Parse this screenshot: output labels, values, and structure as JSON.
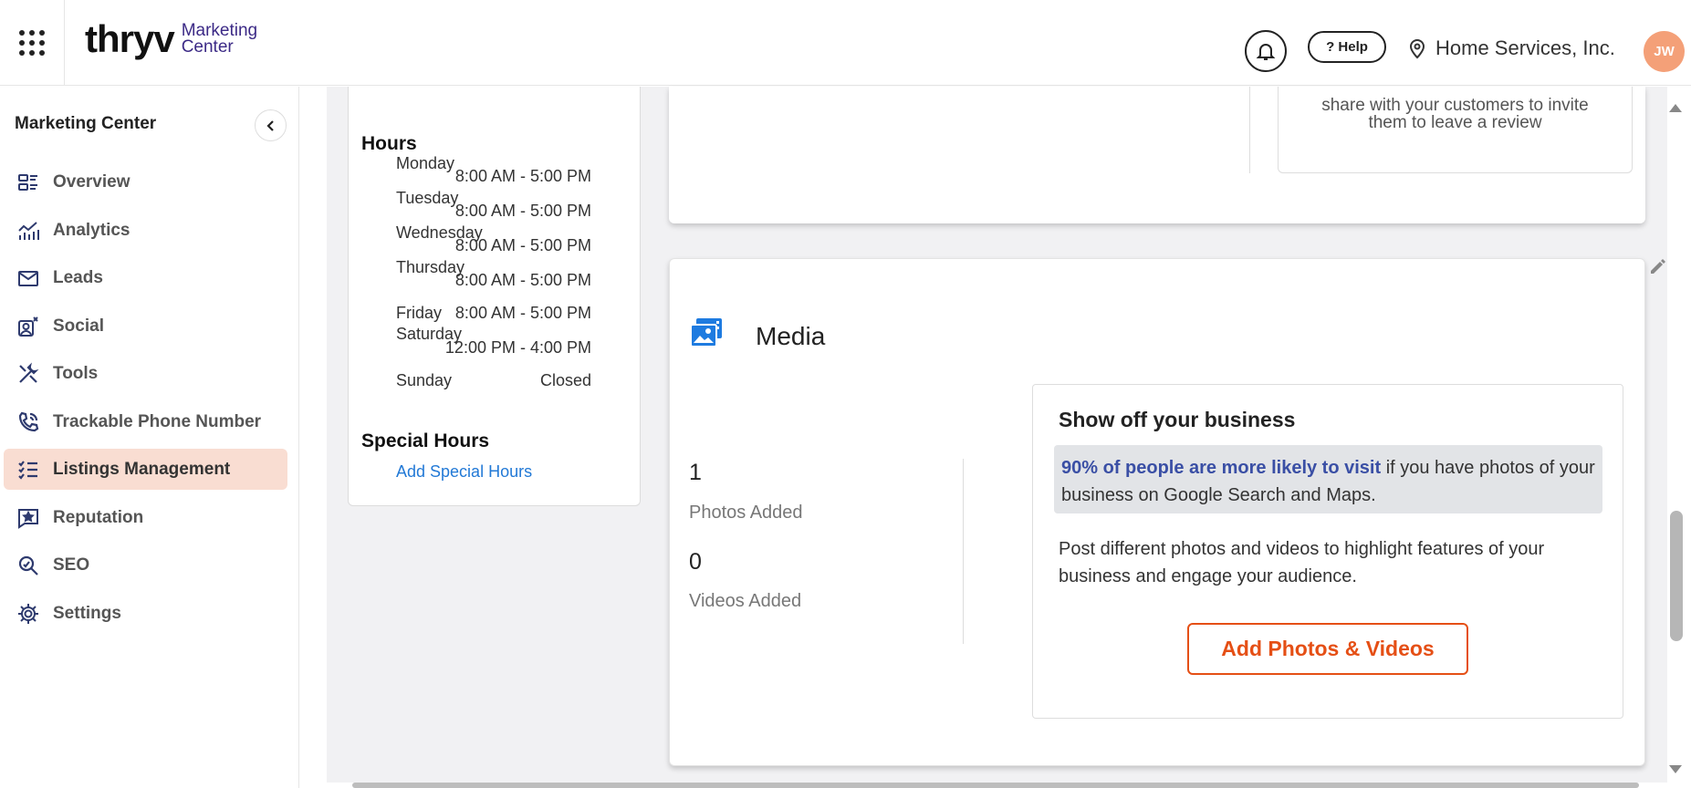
{
  "header": {
    "logo_text": "thryv",
    "logo_sub_line1": "Marketing",
    "logo_sub_line2": "Center",
    "help_label": "? Help",
    "location_name": "Home Services, Inc.",
    "avatar_initials": "JW"
  },
  "sidebar": {
    "title": "Marketing Center",
    "items": [
      {
        "label": "Overview",
        "icon": "overview-icon"
      },
      {
        "label": "Analytics",
        "icon": "analytics-icon"
      },
      {
        "label": "Leads",
        "icon": "mail-icon"
      },
      {
        "label": "Social",
        "icon": "social-icon"
      },
      {
        "label": "Tools",
        "icon": "tools-icon"
      },
      {
        "label": "Trackable Phone Number",
        "icon": "phone-icon"
      },
      {
        "label": "Listings Management",
        "icon": "list-check-icon",
        "active": true
      },
      {
        "label": "Reputation",
        "icon": "star-chat-icon"
      },
      {
        "label": "SEO",
        "icon": "seo-icon"
      },
      {
        "label": "Settings",
        "icon": "gear-icon"
      }
    ]
  },
  "hours": {
    "title": "Hours",
    "days": [
      {
        "day": "Monday",
        "time": "8:00 AM - 5:00 PM"
      },
      {
        "day": "Tuesday",
        "time": "8:00 AM - 5:00 PM"
      },
      {
        "day": "Wednesday",
        "time": "8:00 AM - 5:00 PM"
      },
      {
        "day": "Thursday",
        "time": "8:00 AM - 5:00 PM"
      },
      {
        "day": "Friday",
        "time": "8:00 AM - 5:00 PM"
      },
      {
        "day": "Saturday",
        "time": "12:00 PM - 4:00 PM"
      },
      {
        "day": "Sunday",
        "time": "Closed"
      }
    ],
    "special_title": "Special Hours",
    "special_link": "Add Special Hours"
  },
  "review": {
    "text_line1": "share with your customers to invite",
    "text_line2": "them to leave a review"
  },
  "media": {
    "title": "Media",
    "photos_count": "1",
    "photos_label": "Photos Added",
    "videos_count": "0",
    "videos_label": "Videos Added",
    "showoff_title": "Show off your business",
    "highlight_em": "90% of people are more likely to visit",
    "highlight_rest": " if you have photos of your business on Google Search and Maps.",
    "body": "Post different photos and videos to highlight features of your business and engage your audience.",
    "button_label": "Add Photos & Videos"
  },
  "colors": {
    "brand_orange": "#e54f15",
    "active_nav_bg": "#f9ddd2",
    "link_blue": "#2279d6",
    "highlight_blue": "#3a4fa5"
  }
}
